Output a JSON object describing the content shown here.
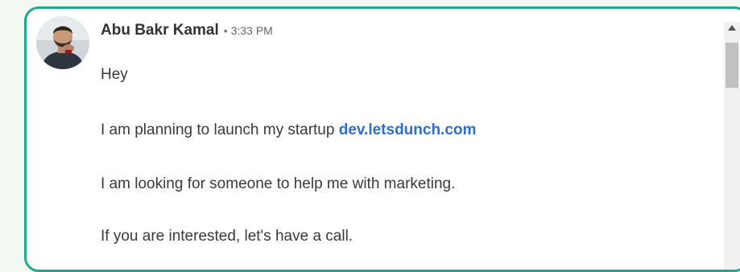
{
  "message": {
    "sender": "Abu Bakr Kamal",
    "separator": "•",
    "time": "3:33 PM",
    "lines": {
      "greeting": "Hey",
      "line2_prefix": "I am planning to launch my startup ",
      "line2_link": "dev.letsdunch.com",
      "line3": "I am looking for someone to help me with marketing.",
      "line4": "If you are interested, let's have a call."
    }
  },
  "colors": {
    "border": "#1ea98a",
    "link": "#2a6ed2",
    "text": "#3a3a3a"
  },
  "icons": {
    "avatar": "user-avatar-photo",
    "scroll_up": "chevron-up-icon"
  }
}
